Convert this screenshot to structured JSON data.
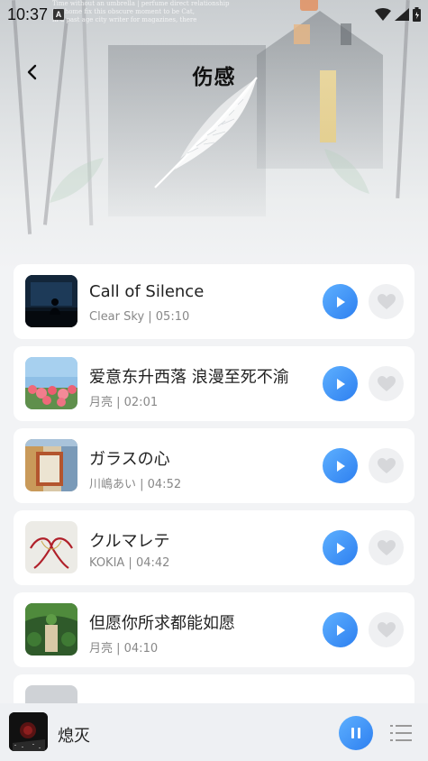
{
  "status_bar": {
    "time": "10:37",
    "notification_badge": "A"
  },
  "header": {
    "title": "伤感",
    "hero_text_lines": [
      "Time without an umbrella | perfume direct relationship",
      "the home fix this obscure moment to be Cat,",
      "in a past age city writer for magazines, there"
    ]
  },
  "songs": [
    {
      "title": "Call of Silence",
      "artist": "Clear Sky",
      "duration": "05:10",
      "meta": "Clear Sky | 05:10"
    },
    {
      "title": "爱意东升西落 浪漫至死不渝",
      "artist": "月亮",
      "duration": "02:01",
      "meta": "月亮 | 02:01"
    },
    {
      "title": "ガラスの心",
      "artist": "川嶋あい",
      "duration": "04:52",
      "meta": "川嶋あい | 04:52"
    },
    {
      "title": "クルマレテ",
      "artist": "KOKIA",
      "duration": "04:42",
      "meta": "KOKIA | 04:42"
    },
    {
      "title": "但愿你所求都能如愿",
      "artist": "月亮",
      "duration": "04:10",
      "meta": "月亮 | 04:10"
    }
  ],
  "mini_player": {
    "title": "熄灭",
    "state": "playing"
  },
  "icons": {
    "back": "chevron-left-icon",
    "play": "play-icon",
    "like": "heart-icon",
    "pause": "pause-icon",
    "playlist": "playlist-icon"
  },
  "colors": {
    "accent": "#2d7ff0",
    "accent_light": "#5eb0ff",
    "like_bg": "#eff0f2",
    "heart": "#d6d7da"
  }
}
